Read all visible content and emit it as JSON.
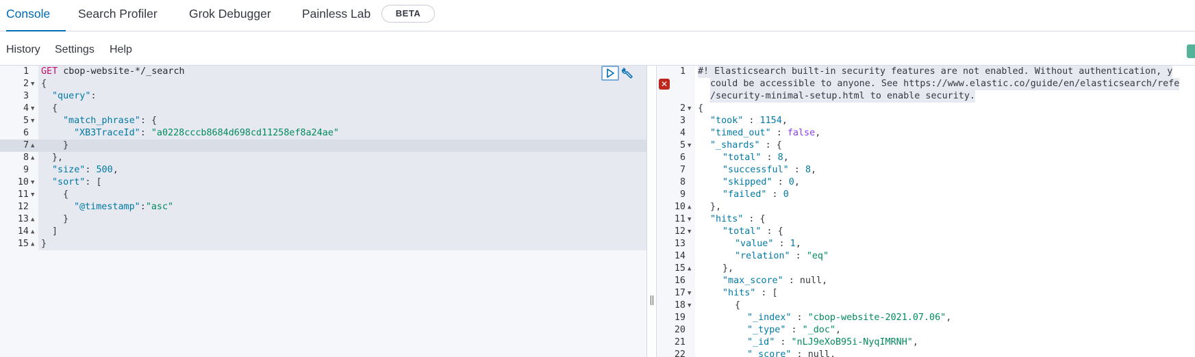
{
  "tabs": [
    {
      "label": "Console",
      "active": true
    },
    {
      "label": "Search Profiler",
      "active": false
    },
    {
      "label": "Grok Debugger",
      "active": false
    },
    {
      "label": "Painless Lab",
      "active": false
    }
  ],
  "beta_badge": "BETA",
  "menu": {
    "history": "History",
    "settings": "Settings",
    "help": "Help"
  },
  "colors": {
    "accent": "#006bb4",
    "method": "#c80a68",
    "string": "#008a5e",
    "number": "#0079a5",
    "boolean": "#8a3cf0",
    "error": "#bd271e"
  },
  "request": {
    "method": "GET",
    "url": "cbop-website-*/_search",
    "lines": [
      {
        "n": "1",
        "fold": ""
      },
      {
        "n": "2",
        "fold": "▼",
        "text": "{"
      },
      {
        "n": "3",
        "fold": "",
        "key": "\"query\"",
        "after": ":"
      },
      {
        "n": "4",
        "fold": "▼",
        "text": "{"
      },
      {
        "n": "5",
        "fold": "▼",
        "key": "\"match_phrase\"",
        "after": ": {"
      },
      {
        "n": "6",
        "fold": "",
        "key": "\"XB3TraceId\"",
        "after": ": ",
        "str": "\"a0228cccb8684d698cd11258ef8a24ae\""
      },
      {
        "n": "7",
        "fold": "▲",
        "text": "}"
      },
      {
        "n": "8",
        "fold": "▲",
        "text": "},"
      },
      {
        "n": "9",
        "fold": "",
        "key": "\"size\"",
        "after": ": ",
        "num": "500",
        "tail": ","
      },
      {
        "n": "10",
        "fold": "▼",
        "key": "\"sort\"",
        "after": ": ["
      },
      {
        "n": "11",
        "fold": "▼",
        "text": "{"
      },
      {
        "n": "12",
        "fold": "",
        "key": "\"@timestamp\"",
        "after": ":",
        "str": "\"asc\""
      },
      {
        "n": "13",
        "fold": "▲",
        "text": "}"
      },
      {
        "n": "14",
        "fold": "▲",
        "text": "]"
      },
      {
        "n": "15",
        "fold": "▲",
        "text": "}"
      }
    ]
  },
  "response": {
    "warning_lines": [
      "#! Elasticsearch built-in security features are not enabled. Without authentication, y",
      "could be accessible to anyone. See https://www.elastic.co/guide/en/elasticsearch/refe",
      "/security-minimal-setup.html to enable security."
    ],
    "lines": [
      {
        "n": "2",
        "fold": "▼",
        "text": "{"
      },
      {
        "n": "3",
        "fold": "",
        "key": "\"took\"",
        "after": " : ",
        "num": "1154",
        "tail": ","
      },
      {
        "n": "4",
        "fold": "",
        "key": "\"timed_out\"",
        "after": " : ",
        "bool": "false",
        "tail": ","
      },
      {
        "n": "5",
        "fold": "▼",
        "key": "\"_shards\"",
        "after": " : {"
      },
      {
        "n": "6",
        "fold": "",
        "key": "\"total\"",
        "after": " : ",
        "num": "8",
        "tail": ","
      },
      {
        "n": "7",
        "fold": "",
        "key": "\"successful\"",
        "after": " : ",
        "num": "8",
        "tail": ","
      },
      {
        "n": "8",
        "fold": "",
        "key": "\"skipped\"",
        "after": " : ",
        "num": "0",
        "tail": ","
      },
      {
        "n": "9",
        "fold": "",
        "key": "\"failed\"",
        "after": " : ",
        "num": "0",
        "tail": ""
      },
      {
        "n": "10",
        "fold": "▲",
        "text": "},"
      },
      {
        "n": "11",
        "fold": "▼",
        "key": "\"hits\"",
        "after": " : {"
      },
      {
        "n": "12",
        "fold": "▼",
        "key": "\"total\"",
        "after": " : {"
      },
      {
        "n": "13",
        "fold": "",
        "key": "\"value\"",
        "after": " : ",
        "num": "1",
        "tail": ","
      },
      {
        "n": "14",
        "fold": "",
        "key": "\"relation\"",
        "after": " : ",
        "str": "\"eq\""
      },
      {
        "n": "15",
        "fold": "▲",
        "text": "},"
      },
      {
        "n": "16",
        "fold": "",
        "key": "\"max_score\"",
        "after": " : ",
        "null": "null",
        "tail": ","
      },
      {
        "n": "17",
        "fold": "▼",
        "key": "\"hits\"",
        "after": " : ["
      },
      {
        "n": "18",
        "fold": "▼",
        "text": "{"
      },
      {
        "n": "19",
        "fold": "",
        "key": "\"_index\"",
        "after": " : ",
        "str": "\"cbop-website-2021.07.06\"",
        "tail": ","
      },
      {
        "n": "20",
        "fold": "",
        "key": "\"_type\"",
        "after": " : ",
        "str": "\"_doc\"",
        "tail": ","
      },
      {
        "n": "21",
        "fold": "",
        "key": "\"_id\"",
        "after": " : ",
        "str": "\"nLJ9eXoB95i-NyqIMRNH\"",
        "tail": ","
      },
      {
        "n": "22",
        "fold": "",
        "key": "\"_score\"",
        "after": " : ",
        "null": "null",
        "tail": ","
      }
    ]
  }
}
